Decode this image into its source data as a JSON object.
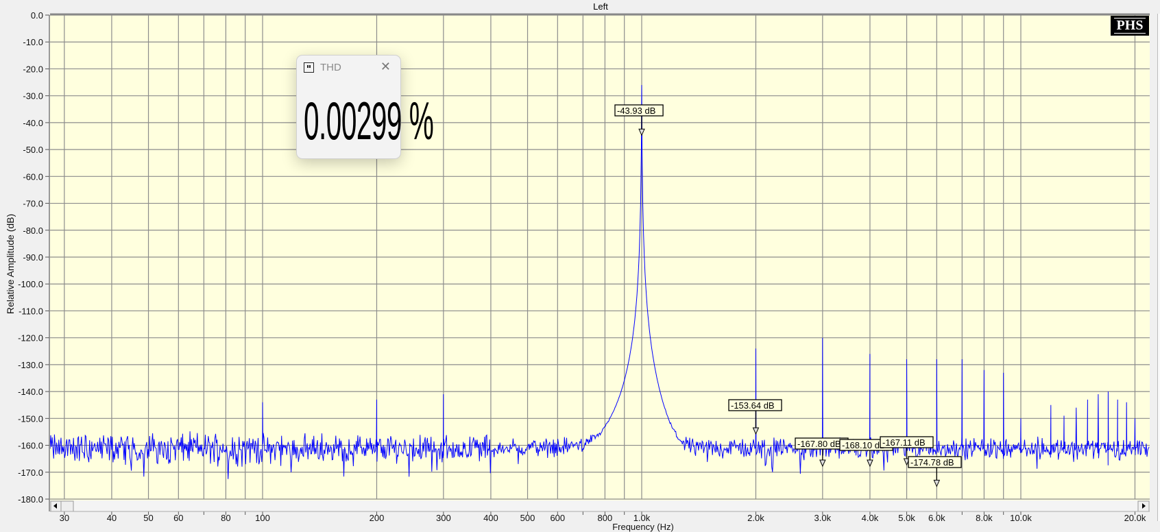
{
  "window": {
    "title": "Left",
    "logo": "PHS"
  },
  "thd_popup": {
    "title": "THD",
    "value": "0.00299 %",
    "close_icon": "close-icon",
    "pin_icon": "pause-icon"
  },
  "colors": {
    "plot_bg": "#ffffde",
    "trace": "#0000ff",
    "grid": "#8c8c8c"
  },
  "chart_data": {
    "type": "line",
    "title": "Left",
    "xlabel": "Frequency (Hz)",
    "ylabel": "Relative Amplitude (dB)",
    "xscale": "log",
    "xlim": [
      27.5,
      21800
    ],
    "ylim": [
      -180,
      0
    ],
    "grid": true,
    "y_ticks": [
      "0.0",
      "-10.0",
      "-20.0",
      "-30.0",
      "-40.0",
      "-50.0",
      "-60.0",
      "-70.0",
      "-80.0",
      "-90.0",
      "-100.0",
      "-110.0",
      "-120.0",
      "-130.0",
      "-140.0",
      "-150.0",
      "-160.0",
      "-170.0",
      "-180.0"
    ],
    "x_ticks": [
      {
        "f": 30,
        "label": "30"
      },
      {
        "f": 40,
        "label": "40"
      },
      {
        "f": 50,
        "label": "50"
      },
      {
        "f": 60,
        "label": "60"
      },
      {
        "f": 80,
        "label": "80"
      },
      {
        "f": 100,
        "label": "100"
      },
      {
        "f": 200,
        "label": "200"
      },
      {
        "f": 300,
        "label": "300"
      },
      {
        "f": 400,
        "label": "400"
      },
      {
        "f": 500,
        "label": "500"
      },
      {
        "f": 600,
        "label": "600"
      },
      {
        "f": 800,
        "label": "800"
      },
      {
        "f": 1000,
        "label": "1.0k"
      },
      {
        "f": 2000,
        "label": "2.0k"
      },
      {
        "f": 3000,
        "label": "3.0k"
      },
      {
        "f": 4000,
        "label": "4.0k"
      },
      {
        "f": 5000,
        "label": "5.0k"
      },
      {
        "f": 6000,
        "label": "6.0k"
      },
      {
        "f": 8000,
        "label": "8.0k"
      },
      {
        "f": 10000,
        "label": "10.0k"
      },
      {
        "f": 20000,
        "label": "20.0k"
      }
    ],
    "noise_floor_db": -161,
    "peaks": [
      {
        "f": 100,
        "db": -144
      },
      {
        "f": 200,
        "db": -143
      },
      {
        "f": 300,
        "db": -141
      },
      {
        "f": 1000,
        "db": -26
      },
      {
        "f": 2000,
        "db": -124
      },
      {
        "f": 3000,
        "db": -120
      },
      {
        "f": 4000,
        "db": -126
      },
      {
        "f": 5000,
        "db": -128
      },
      {
        "f": 6000,
        "db": -128
      },
      {
        "f": 7000,
        "db": -128
      },
      {
        "f": 8000,
        "db": -132
      },
      {
        "f": 9000,
        "db": -133
      },
      {
        "f": 10000,
        "db": -150
      },
      {
        "f": 12000,
        "db": -145
      },
      {
        "f": 13000,
        "db": -149
      },
      {
        "f": 14000,
        "db": -146
      },
      {
        "f": 15000,
        "db": -143
      },
      {
        "f": 16000,
        "db": -141
      },
      {
        "f": 17000,
        "db": -140
      },
      {
        "f": 18000,
        "db": -143
      },
      {
        "f": 19000,
        "db": -144
      },
      {
        "f": 20000,
        "db": -150
      }
    ],
    "markers": [
      {
        "f": 1000,
        "db": -43.93,
        "label": "-43.93 dB"
      },
      {
        "f": 2000,
        "db": -155,
        "label": "-153.64 dB"
      },
      {
        "f": 3000,
        "db": -167,
        "label": "-167.80 dB"
      },
      {
        "f": 4000,
        "db": -167,
        "label": "-168.10 dB"
      },
      {
        "f": 5000,
        "db": -166.5,
        "label": "-167.11 dB"
      },
      {
        "f": 6000,
        "db": -174.5,
        "label": "-174.78 dB"
      }
    ]
  }
}
